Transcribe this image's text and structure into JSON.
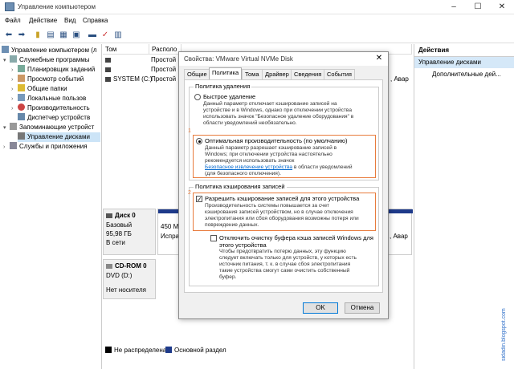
{
  "window": {
    "title": "Управление компьютером"
  },
  "menu": [
    "Файл",
    "Действие",
    "Вид",
    "Справка"
  ],
  "tree": {
    "items": [
      "Управление компьютером (л",
      "Служебные программы",
      "Планировщик заданий",
      "Просмотр событий",
      "Общие папки",
      "Локальные пользов",
      "Производительность",
      "Диспетчер устройств",
      "Запоминающие устройст",
      "Управление дисками",
      "Службы и приложения"
    ]
  },
  "columns": [
    "Том",
    "Располо"
  ],
  "volumes": [
    {
      "name": "",
      "layout": "Простой"
    },
    {
      "name": "",
      "layout": "Простой"
    },
    {
      "name": "SYSTEM (C:)",
      "layout": "Простой"
    }
  ],
  "right_fragment": {
    "row3": ", Авар",
    "disk": ", Авар"
  },
  "disks": [
    {
      "name": "Диск 0",
      "type": "Базовый",
      "size": "95,98 ГБ",
      "status": "В сети",
      "part_size": "450 МБ",
      "part_status": "Испра"
    },
    {
      "name": "CD-ROM 0",
      "type": "DVD (D:)",
      "size": "",
      "status": "Нет носителя"
    }
  ],
  "legend": [
    "Не распределена",
    "Основной раздел"
  ],
  "actions": {
    "header": "Действия",
    "section": "Управление дисками",
    "item": "Дополнительные дей..."
  },
  "watermark": "sidadin.blogspot.com",
  "dialog": {
    "title": "Свойства: VMware Virtual NVMe Disk",
    "tabs": [
      "Общие",
      "Политика",
      "Тома",
      "Драйвер",
      "Сведения",
      "События"
    ],
    "removal_group": "Политика удаления",
    "quick_removal": {
      "label": "Быстрое удаление",
      "desc": [
        "Данный параметр отключает кэширование записей на",
        "устройстве и в Windows, однако при отключении устройства",
        "использовать значок \"Безопасное удаление оборудования\" в",
        "области уведомлений необязательно."
      ]
    },
    "marker1": "1",
    "optimal": {
      "label": "Оптимальная производительность (по умолчанию)",
      "desc": [
        "Данный параметр разрешает кэширование записей в",
        "Windows; при отключении устройства настоятельно",
        "рекомендуется использовать значок"
      ],
      "link": "Безопасное извлечение устройства",
      "desc_tail": " в области уведомлений",
      "desc_end": "(для безопасного отключения)."
    },
    "write_group": "Политика кэширования записей",
    "marker2": "2",
    "enable_cache": {
      "label": "Разрешить кэширование записей для этого устройства",
      "desc": [
        "Производительность системы повышается за счет",
        "кэширования записей устройством, но в случае отключения",
        "электропитания или сбоя оборудования возможны потеря или",
        "повреждение данных."
      ]
    },
    "disable_flush": {
      "label1": "Отключить очистку буфера кэша записей Windows для",
      "label2": "этого устройства",
      "desc": [
        "Чтобы предотвратить потерю данных, эту функцию",
        "следует включать только для устройств, у которых есть",
        "источник питания, т. к. в случае сбоя электропитания",
        "такие устройства смогут сами очистить собственный",
        "буфер."
      ]
    },
    "ok": "OK",
    "cancel": "Отмена"
  }
}
